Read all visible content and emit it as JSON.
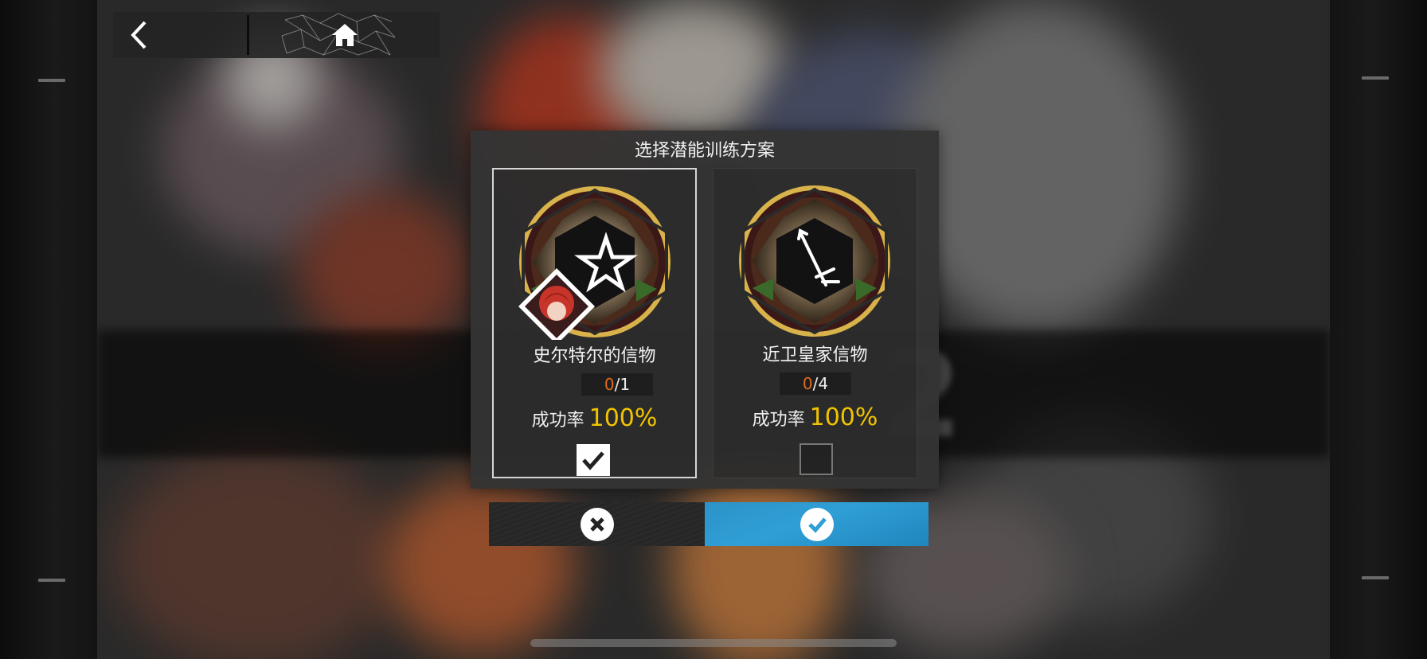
{
  "nav": {
    "back_icon": "chevron-left-icon",
    "home_icon": "home-icon"
  },
  "dialog": {
    "title": "选择潜能训练方案",
    "options": [
      {
        "name": "史尔特尔的信物",
        "owned": "0",
        "required": "/1",
        "rate_label": "成功率",
        "rate_value": "100%",
        "selected": true,
        "emblem_icon": "operator-token-icon"
      },
      {
        "name": "近卫皇家信物",
        "owned": "0",
        "required": "/4",
        "rate_label": "成功率",
        "rate_value": "100%",
        "selected": false,
        "emblem_icon": "guard-sword-icon"
      }
    ]
  },
  "buttons": {
    "cancel_icon": "close-icon",
    "confirm_icon": "check-icon"
  },
  "colors": {
    "accent_blue": "#2f9fd6",
    "rate_yellow": "#f2c400",
    "owned_orange": "#e06a1e"
  }
}
